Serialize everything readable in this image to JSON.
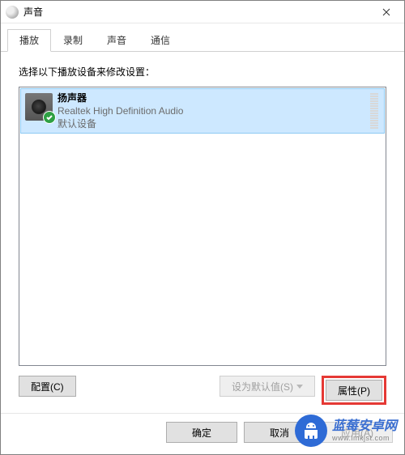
{
  "window": {
    "title": "声音"
  },
  "tabs": {
    "playback": "播放",
    "recording": "录制",
    "sounds": "声音",
    "comm": "通信"
  },
  "instruction": "选择以下播放设备来修改设置：",
  "device": {
    "name": "扬声器",
    "driver": "Realtek High Definition Audio",
    "status": "默认设备"
  },
  "buttons": {
    "configure": "配置(C)",
    "set_default": "设为默认值(S)",
    "properties": "属性(P)",
    "ok": "确定",
    "cancel": "取消",
    "apply": "应用(A)"
  },
  "watermark": {
    "brand": "蓝莓安卓网",
    "url": "www.lmkjst.com"
  }
}
